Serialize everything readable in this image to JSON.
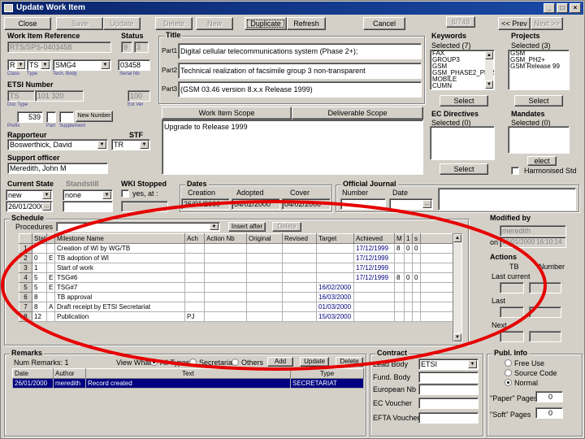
{
  "window": {
    "title": "Update Work Item"
  },
  "toolbar": {
    "close": "Close",
    "save": "Save",
    "update": "Update",
    "delete": "Delete",
    "new": "New",
    "duplicate": "Duplicate",
    "refresh": "Refresh",
    "cancel": "Cancel",
    "counter": "8/748",
    "prev": "<< Prev",
    "next": "Next >>"
  },
  "wi_ref": {
    "label": "Work Item Reference",
    "value": "RTS/SPS-0403458",
    "type": "R",
    "tech_body": "TS",
    "body": "SMG4",
    "serial": "03458",
    "sub_type": "Class",
    "type_lbl": "Type",
    "tech_lbl": "Tech. Body",
    "serial_lbl": "Serial Nb"
  },
  "status": {
    "label": "Status",
    "v1": "9",
    "v2": "3"
  },
  "etsi": {
    "label": "ETSI Number",
    "v1": "TS",
    "v2": "101 320",
    "v3": "100",
    "sub1": "Doc Type",
    "sub2": "Doc Nb",
    "sub3": "Part",
    "sub4": "Supplement",
    "sub5": "Ext Ver",
    "prefix": "Prefix",
    "nr": "539",
    "new_number": "New Number"
  },
  "title": {
    "label": "Title",
    "part1_lbl": "Part1",
    "part2_lbl": "Part2",
    "part3_lbl": "Part3",
    "part1": "Digital cellular telecommunications system (Phase 2+);",
    "part2": "Technical realization of facsimile group 3 non-transparent",
    "part3": "(GSM 03.46 version 8.x.x Release 1999)"
  },
  "scope": {
    "tab1": "Work Item Scope",
    "tab2": "Deliverable Scope",
    "text": "Upgrade to Release 1999"
  },
  "keywords": {
    "label": "Keywords",
    "selected": "Selected (7)",
    "items": [
      "FAX",
      "GROUP3",
      "GSM",
      "GSM_PHASE2_PLUS",
      "MOBILE",
      "CUMN"
    ],
    "select": "Select"
  },
  "projects": {
    "label": "Projects",
    "selected": "Selected (3)",
    "items": [
      "GSM",
      "GSM_PH2+",
      "GSM Release 99"
    ],
    "select": "Select"
  },
  "ec": {
    "label": "EC Directives",
    "selected": "Selected (0)",
    "select": "Select"
  },
  "mandates": {
    "label": "Mandates",
    "selected": "Selected (0)",
    "elect": "elect",
    "harmonised": "Harmonised Std"
  },
  "rapporteur": {
    "label": "Rapporteur",
    "value": "Boswerthick, David",
    "stf_label": "STF",
    "stf_value": "TR",
    "support_label": "Support officer",
    "support_value": "Meredith, John M"
  },
  "current_state": {
    "label": "Current State",
    "value": "new",
    "date": "26/01/2000",
    "standstill_label": "Standstill",
    "standstill_value": "none",
    "wki_label": "WKI Stopped",
    "wki_yes": "yes, at :"
  },
  "dates": {
    "label": "Dates",
    "creation_lbl": "Creation",
    "adopted_lbl": "Adopted",
    "cover_lbl": "Cover",
    "creation": "26/01/2000",
    "adopted": "04/02/2000",
    "cover": "04/02/2000"
  },
  "oj": {
    "label": "Official Journal",
    "number_lbl": "Number",
    "date_lbl": "Date"
  },
  "schedule": {
    "label": "Schedule",
    "procedures_lbl": "Procedures",
    "insert_after": "Insert after",
    "delete": "Delete",
    "headers": [
      "Stat",
      "Milestone Name",
      "Ach",
      "Action Nb",
      "Original",
      "Revised",
      "Target",
      "Achieved",
      "M",
      "1",
      "s"
    ],
    "rows": [
      {
        "rh": "1",
        "stat": "",
        "flag": "",
        "name": "Creation of WI by WG/TB",
        "ach": "",
        "action": "",
        "orig": "",
        "rev": "",
        "target": "",
        "achieved": "17/12/1999",
        "m": "8",
        "n1": "0",
        "s": "0"
      },
      {
        "rh": "2",
        "stat": "0",
        "flag": "E",
        "name": "TB adoption of WI",
        "ach": "",
        "action": "",
        "orig": "",
        "rev": "",
        "target": "",
        "achieved": "17/12/1999",
        "m": "",
        "n1": "",
        "s": ""
      },
      {
        "rh": "3",
        "stat": "1",
        "flag": "",
        "name": "Start of work",
        "ach": "",
        "action": "",
        "orig": "",
        "rev": "",
        "target": "",
        "achieved": "17/12/1999",
        "m": "",
        "n1": "",
        "s": ""
      },
      {
        "rh": "4",
        "stat": "5",
        "flag": "E",
        "name": "TSG#6",
        "ach": "",
        "action": "",
        "orig": "",
        "rev": "",
        "target": "",
        "achieved": "17/12/1999",
        "m": "8",
        "n1": "0",
        "s": "0"
      },
      {
        "rh": "5",
        "stat": "5",
        "flag": "E",
        "name": "TSG#7",
        "ach": "",
        "action": "",
        "orig": "",
        "rev": "",
        "target": "16/02/2000",
        "achieved": "",
        "m": "",
        "n1": "",
        "s": ""
      },
      {
        "rh": "6",
        "stat": "8",
        "flag": "",
        "name": "TB approval",
        "ach": "",
        "action": "",
        "orig": "",
        "rev": "",
        "target": "16/03/2000",
        "achieved": "",
        "m": "",
        "n1": "",
        "s": ""
      },
      {
        "rh": "7",
        "stat": "8",
        "flag": "A",
        "name": "Draft receipt by ETSI Secretariat",
        "ach": "",
        "action": "",
        "orig": "",
        "rev": "",
        "target": "01/03/2000",
        "achieved": "",
        "m": "",
        "n1": "",
        "s": ""
      },
      {
        "rh": "8",
        "stat": "12",
        "flag": "",
        "name": "Publication",
        "ach": "PJ",
        "action": "",
        "orig": "",
        "rev": "",
        "target": "15/03/2000",
        "achieved": "",
        "m": "",
        "n1": "",
        "s": ""
      }
    ]
  },
  "modified": {
    "label": "Modified by",
    "user": "meredith",
    "on_lbl": "on",
    "on": "26/01/2000 16:10:14"
  },
  "actions": {
    "label": "Actions",
    "tb": "TB",
    "number": "Number",
    "last_current": "Last current",
    "last": "Last",
    "next": "Next"
  },
  "remarks": {
    "label": "Remarks",
    "count": "Num Remarks: 1",
    "view_what": "View What:",
    "all_types": "All Types",
    "secretariat": "Secretariat",
    "others": "Others",
    "add": "Add",
    "update": "Update",
    "delete": "Delete",
    "headers": [
      "Date",
      "Author",
      "Text",
      "Type"
    ],
    "row": {
      "date": "26/01/2000",
      "author": "meredith",
      "text": "Record created",
      "type": "SECRETARIAT"
    }
  },
  "contract": {
    "label": "Contract",
    "lead_body": "Lead Body",
    "lead_value": "ETSI",
    "fund_body": "Fund. Body",
    "european_nb": "European Nb",
    "ec_voucher": "EC Voucher",
    "efta_voucher": "EFTA Voucher"
  },
  "publ": {
    "label": "Publ. Info",
    "free_use": "Free Use",
    "source_code": "Source Code",
    "normal": "Normal",
    "paper_pages": "\"Paper\" Pages",
    "soft_pages": "\"Soft\" Pages",
    "paper_val": "0",
    "soft_val": "0"
  },
  "colors": {
    "highlight": "#e60000",
    "title_bar": "#0a246a",
    "selection": "#000080"
  }
}
